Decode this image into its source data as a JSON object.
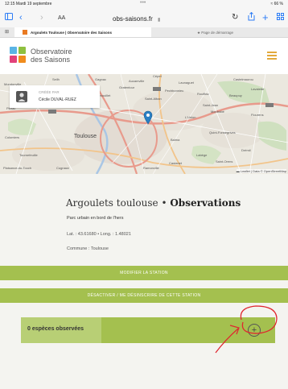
{
  "status_bar": {
    "time_date": "12:15  Mardi 19 septembre",
    "dots": "•••",
    "battery": "≈ 66 %"
  },
  "browser": {
    "text_size_label": "AA",
    "url": "obs-saisons.fr",
    "tabs": [
      {
        "title": "Argoulets Toulouse | Observatoire des Saisons",
        "active": true
      },
      {
        "title": "★ Page de démarrage",
        "active": false
      }
    ]
  },
  "site": {
    "logo_line1": "Observatoire",
    "logo_line2": "des Saisons"
  },
  "map": {
    "creator_label": "CRÉÉE PAR",
    "creator_name": "Cécile DUVAL-RUEZ",
    "attribution": "▬ Leaflet | Data © OpenStreetMap",
    "place_labels": {
      "toulouse": "Toulouse",
      "balma": "Balma",
      "launaguet": "Launaguet",
      "lavalette": "Lavalette",
      "beaupuy": "Beaupuy",
      "saint_jean": "Saint-Jean",
      "l_union": "L'Union",
      "blagnac": "Blagnac",
      "tournefeuille": "Tournefeuille",
      "pibrac": "Pibrac",
      "colomiers": "Colomiers",
      "quint": "Quint-Fonsegrives",
      "flourens": "Flourens",
      "dremil": "Drémil",
      "aucamville": "Aucamville",
      "seilh": "Seilh",
      "mondonville": "Mondonville",
      "cornebarrieu": "Cornebarrieu",
      "plaisance": "Plaisance-du-Touch",
      "cugnaux": "Cugnaux",
      "ramonville": "Ramonville",
      "castanet": "Castanet",
      "labege": "Labège",
      "saint_orens": "Saint-Orens",
      "montrabe": "Montrabé",
      "rouffiac": "Rouffiac",
      "pechbonnieu": "Pechbonnieu",
      "cepet": "Cépet",
      "gagnac": "Gagnac",
      "castelmaurou": "Castelmaurou",
      "saint_alban": "Saint-Alban",
      "fenouillet": "Fenouillet",
      "gratentour": "Gratentour",
      "bruguieres": "Bruguières",
      "saint_jory": "Saint-Jory"
    }
  },
  "station": {
    "title": "Argoulets toulouse",
    "separator": "•",
    "title_suffix": "Observations",
    "description": "Parc urbain en bord de l'hers",
    "coords": "Lat. : 43.61680  •  Long. : 1.48021",
    "commune": "Commune : Toulouse"
  },
  "buttons": {
    "edit": "MODIFIER LA STATION",
    "deactivate": "DÉSACTIVER / ME DÉSINSCRIRE DE CETTE STATION"
  },
  "species": {
    "count_label": "0 espèces observées",
    "add_symbol": "+"
  },
  "colors": {
    "accent_green": "#a4c04f",
    "annotation_red": "#e0262e"
  }
}
